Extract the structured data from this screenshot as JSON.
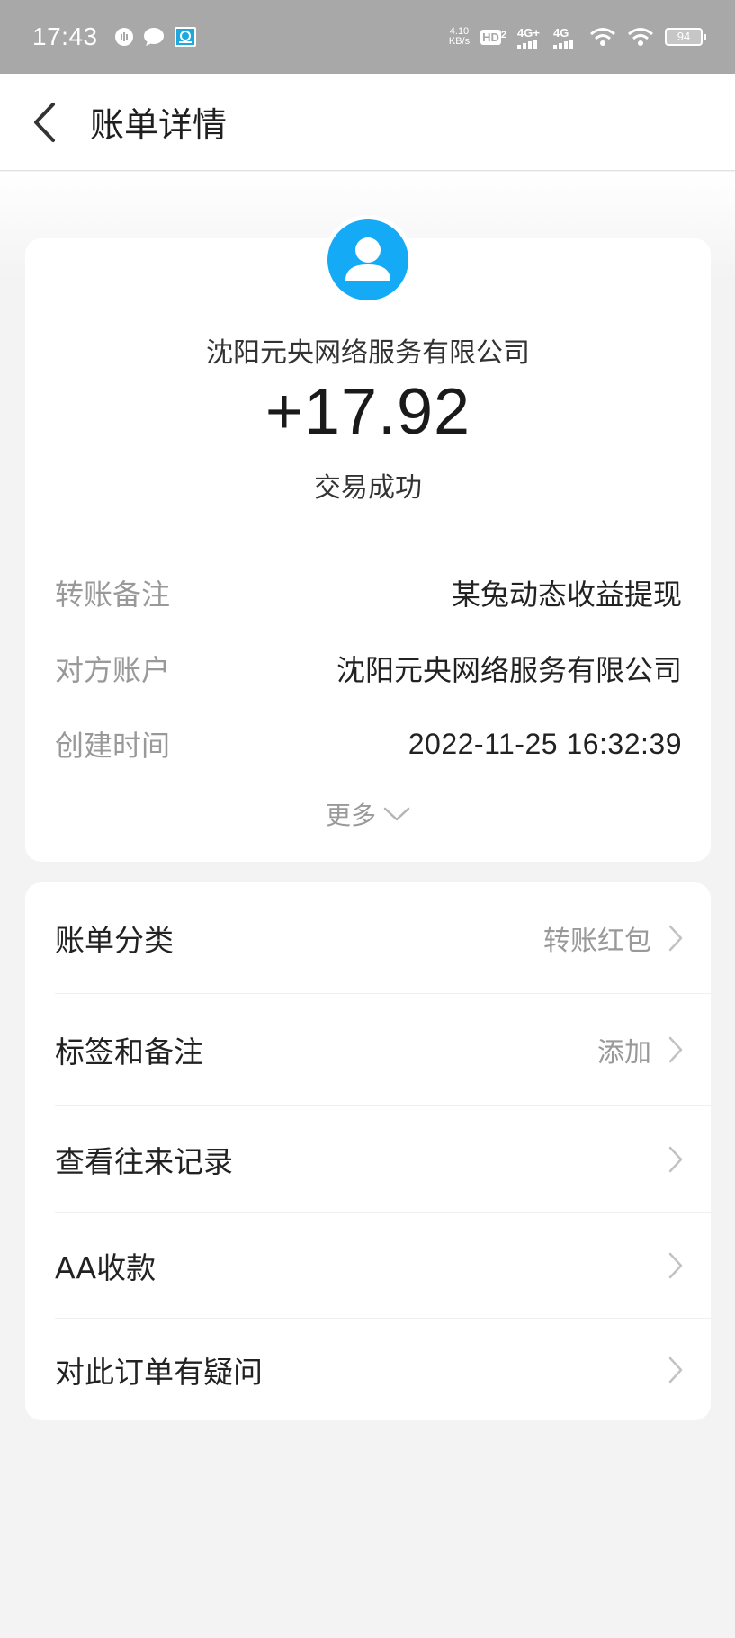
{
  "status_bar": {
    "time": "17:43",
    "speed_value": "4.10",
    "speed_unit": "KB/s",
    "hd_label": "HD",
    "hd_sub": "2",
    "network1": "4G+",
    "network2": "4G",
    "battery": "94",
    "icons": [
      "voice-icon",
      "chat-icon",
      "app-icon",
      "signal-icon",
      "wifi-icon",
      "battery-icon"
    ]
  },
  "nav": {
    "title": "账单详情",
    "back_icon": "chevron-left-icon"
  },
  "summary": {
    "merchant": "沈阳元央网络服务有限公司",
    "amount": "+17.92",
    "status": "交易成功",
    "avatar_color": "#14aaf5"
  },
  "details": [
    {
      "label": "转账备注",
      "value": "某兔动态收益提现"
    },
    {
      "label": "对方账户",
      "value": "沈阳元央网络服务有限公司"
    },
    {
      "label": "创建时间",
      "value": "2022-11-25 16:32:39"
    }
  ],
  "more": {
    "label": "更多"
  },
  "list": [
    {
      "label": "账单分类",
      "value": "转账红包"
    },
    {
      "label": "标签和备注",
      "value": "添加"
    },
    {
      "label": "查看往来记录",
      "value": ""
    },
    {
      "label": "AA收款",
      "value": ""
    },
    {
      "label": "对此订单有疑问",
      "value": ""
    }
  ]
}
